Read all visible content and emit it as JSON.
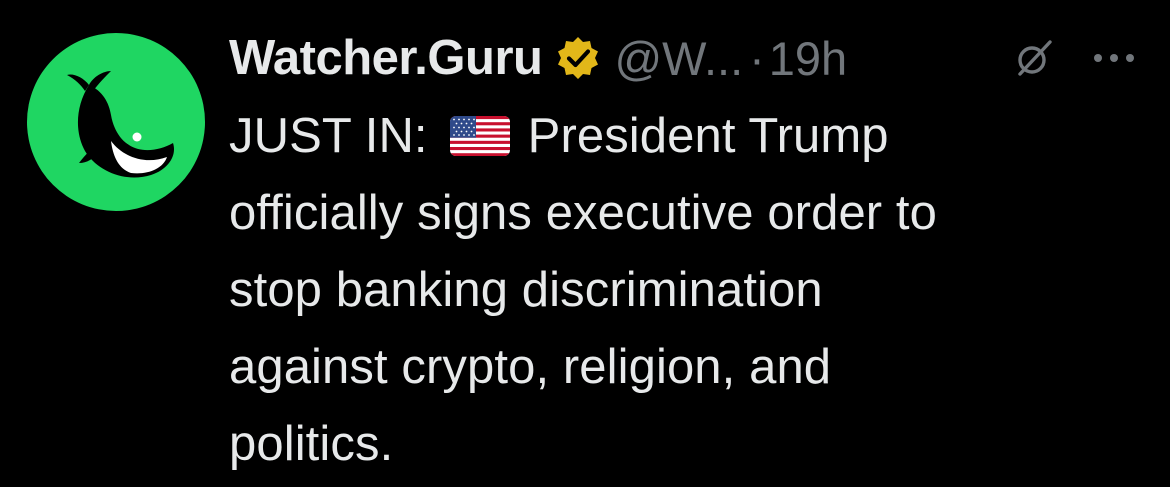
{
  "tweet": {
    "author": {
      "display_name": "Watcher.Guru",
      "handle": "@W...",
      "verified_icon": "gold-verified-badge-icon",
      "avatar_icon": "whale-logo-icon"
    },
    "separator": "·",
    "time": "19h",
    "text_prefix": "JUST IN:",
    "flag_icon": "us-flag-emoji",
    "text_line1_rest": "President Trump",
    "text_line2": "officially signs executive order to",
    "text_line3": "stop banking discrimination",
    "text_line4": "against crypto, religion, and",
    "text_line5": "politics.",
    "actions": {
      "grok_icon": "grok-icon",
      "more_icon": "more-options-icon"
    }
  },
  "colors": {
    "background": "#000000",
    "text_primary": "#e7e9ea",
    "text_secondary": "#71767b",
    "avatar_bg": "#1fd662",
    "verified_gold": "#e2b719"
  }
}
